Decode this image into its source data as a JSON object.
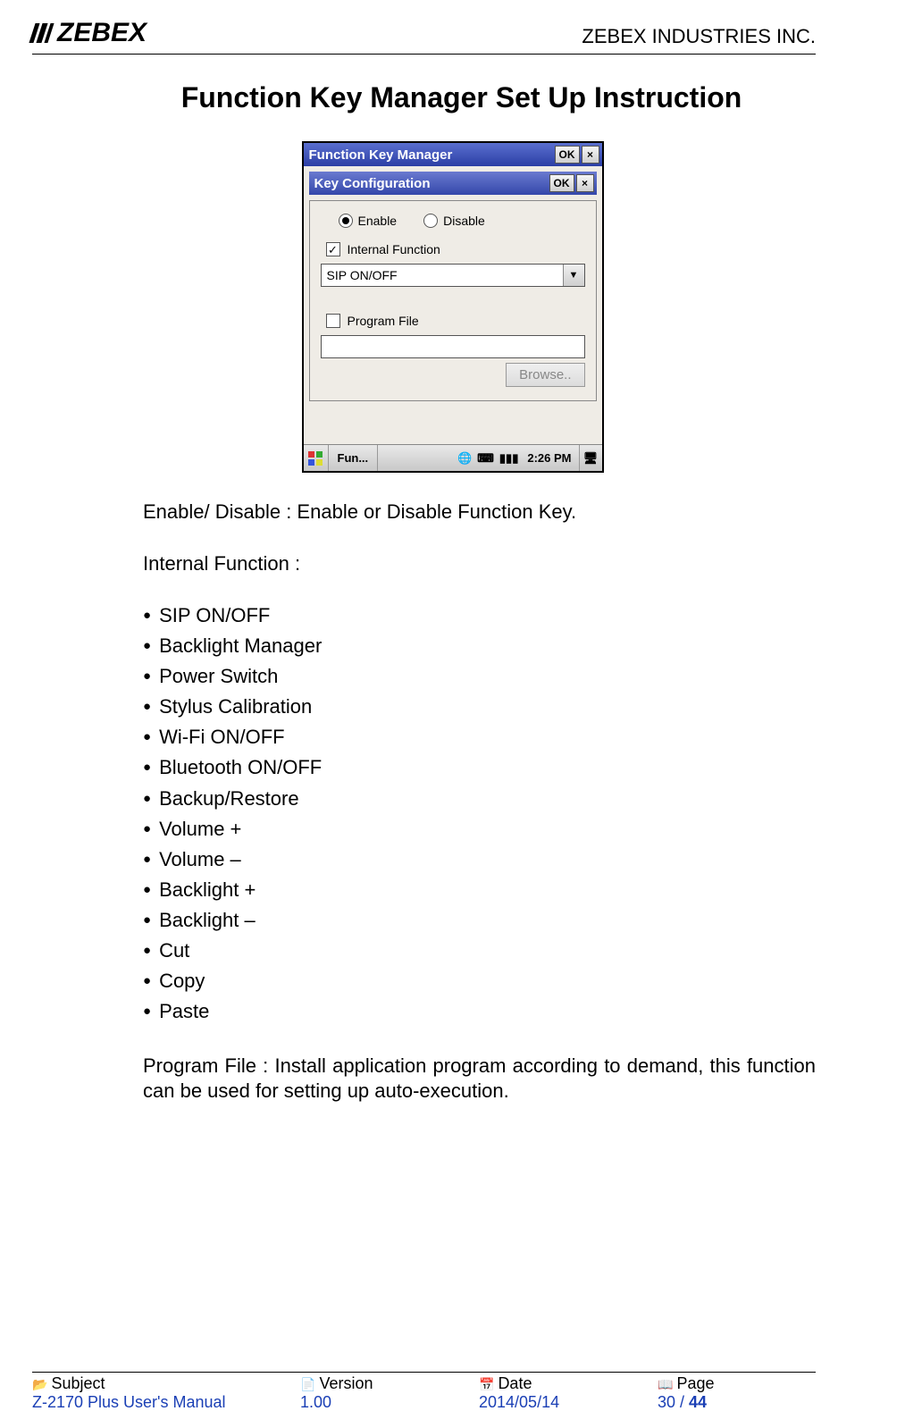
{
  "header": {
    "logo_text": "ZEBEX",
    "company": "ZEBEX INDUSTRIES INC."
  },
  "title": "Function Key Manager Set Up Instruction",
  "screenshot": {
    "topbar": {
      "title": "Function Key Manager",
      "ok": "OK",
      "close": "×"
    },
    "subbar": {
      "title": "Key Configuration",
      "ok": "OK",
      "close": "×"
    },
    "radio_enable": "Enable",
    "radio_disable": "Disable",
    "internal_function_label": "Internal Function",
    "select_value": "SIP ON/OFF",
    "program_file_label": "Program File",
    "browse_label": "Browse..",
    "taskbar": {
      "task_label": "Fun...",
      "time": "2:26 PM"
    }
  },
  "para_enable": "Enable/ Disable : Enable or Disable Function Key.",
  "para_internal": "Internal Function :",
  "functions": [
    "SIP ON/OFF",
    "Backlight Manager",
    "Power Switch",
    "Stylus Calibration",
    "Wi-Fi ON/OFF",
    "Bluetooth ON/OFF",
    "Backup/Restore",
    "Volume +",
    "Volume –",
    "Backlight +",
    "Backlight –",
    "Cut",
    "Copy",
    "Paste"
  ],
  "para_program": "Program File : Install application program according to demand, this function can be used for setting up auto-execution.",
  "footer": {
    "labels": {
      "subject": "Subject",
      "version": "Version",
      "date": "Date",
      "page": "Page"
    },
    "values": {
      "subject": "Z-2170 Plus User's Manual",
      "version": "1.00",
      "date": "2014/05/14",
      "page_current": "30",
      "page_sep": " / ",
      "page_total": "44"
    }
  }
}
